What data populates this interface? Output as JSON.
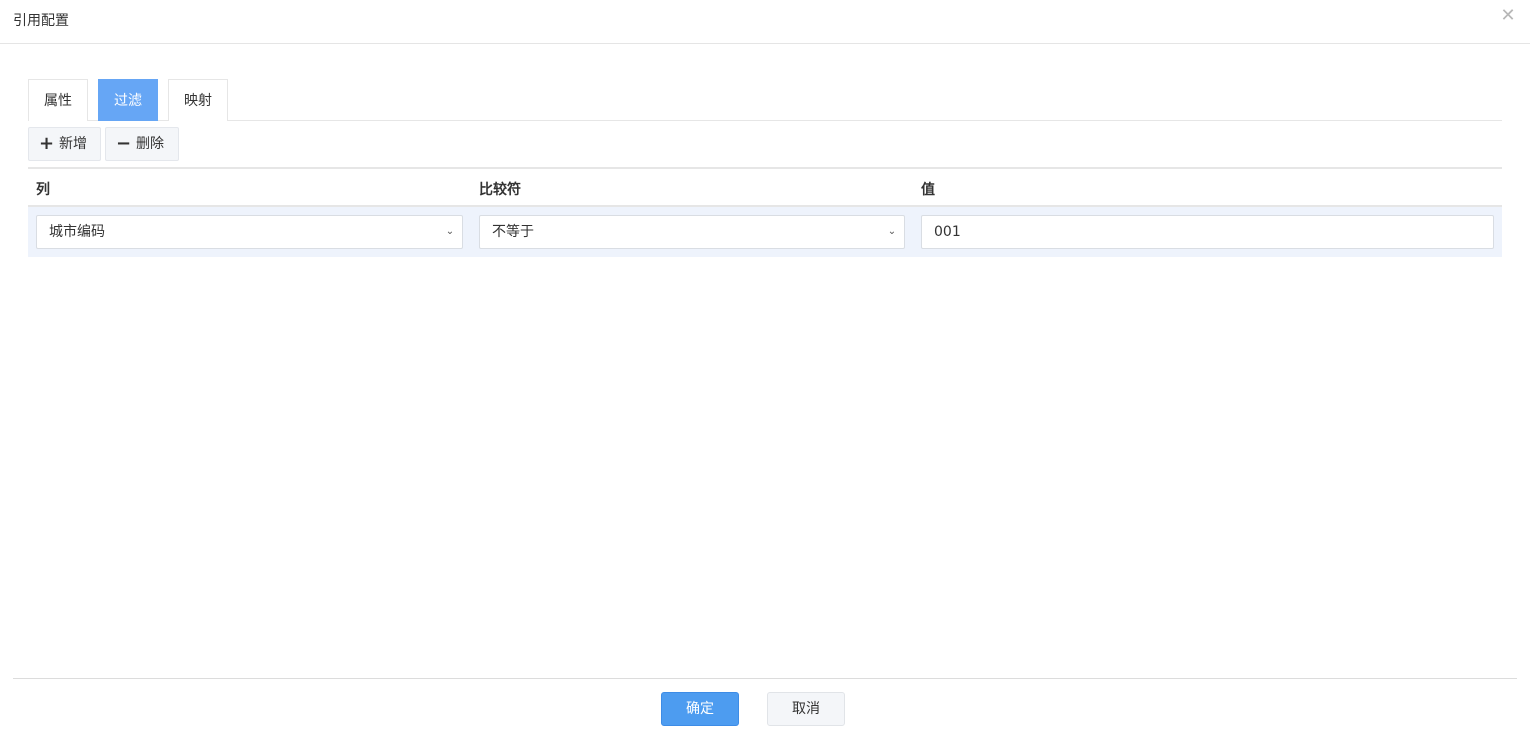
{
  "dialog": {
    "title": "引用配置",
    "close_icon": "close-icon",
    "close_glyph": "✕"
  },
  "tabs": [
    {
      "label": "属性",
      "active": false
    },
    {
      "label": "过滤",
      "active": true
    },
    {
      "label": "映射",
      "active": false
    }
  ],
  "toolbar": {
    "add_label": "新增",
    "add_icon_glyph": "+",
    "delete_label": "删除",
    "delete_icon_glyph": "−"
  },
  "grid": {
    "headers": [
      "列",
      "比较符",
      "值"
    ],
    "rows": [
      {
        "column": "城市编码",
        "operator": "不等于",
        "value": "001"
      }
    ]
  },
  "footer": {
    "ok_label": "确定",
    "cancel_label": "取消"
  },
  "colors": {
    "accent": "#4d9cf0",
    "active_tab": "#66a6f5",
    "row_highlight": "#eef3fc"
  }
}
